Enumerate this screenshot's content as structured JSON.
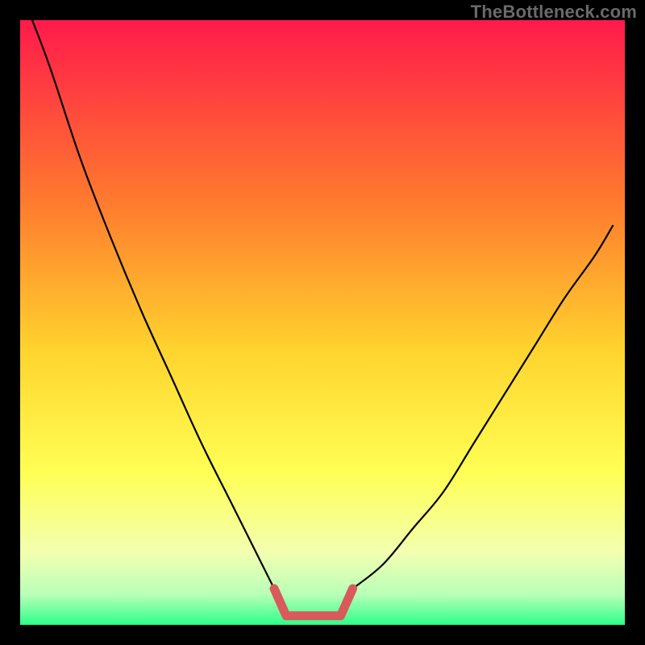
{
  "watermark": "TheBottleneck.com",
  "colors": {
    "frame": "#000000",
    "grad_top": "#ff1a4b",
    "grad_mid1": "#ff7a2e",
    "grad_mid2": "#ffd52e",
    "grad_mid3": "#ffff55",
    "grad_mid4": "#f3ffb0",
    "grad_mid5": "#b8ffb8",
    "grad_bottom": "#2dff8a",
    "curve": "#000000",
    "bracket": "#d85a5a"
  },
  "chart_data": {
    "type": "line",
    "title": "",
    "xlabel": "",
    "ylabel": "",
    "xlim": [
      0,
      1
    ],
    "ylim": [
      0,
      1
    ],
    "series": [
      {
        "name": "left-branch",
        "x": [
          0.02,
          0.05,
          0.1,
          0.15,
          0.2,
          0.25,
          0.3,
          0.35,
          0.4,
          0.42
        ],
        "y": [
          1.0,
          0.92,
          0.77,
          0.64,
          0.52,
          0.41,
          0.3,
          0.2,
          0.1,
          0.06
        ]
      },
      {
        "name": "right-branch",
        "x": [
          0.55,
          0.6,
          0.65,
          0.7,
          0.75,
          0.8,
          0.85,
          0.9,
          0.95,
          0.98
        ],
        "y": [
          0.06,
          0.1,
          0.16,
          0.22,
          0.3,
          0.38,
          0.46,
          0.54,
          0.61,
          0.66
        ]
      },
      {
        "name": "flat-bottom-highlight",
        "x": [
          0.42,
          0.44,
          0.53,
          0.55
        ],
        "y": [
          0.06,
          0.015,
          0.015,
          0.06
        ]
      }
    ],
    "annotations": []
  }
}
